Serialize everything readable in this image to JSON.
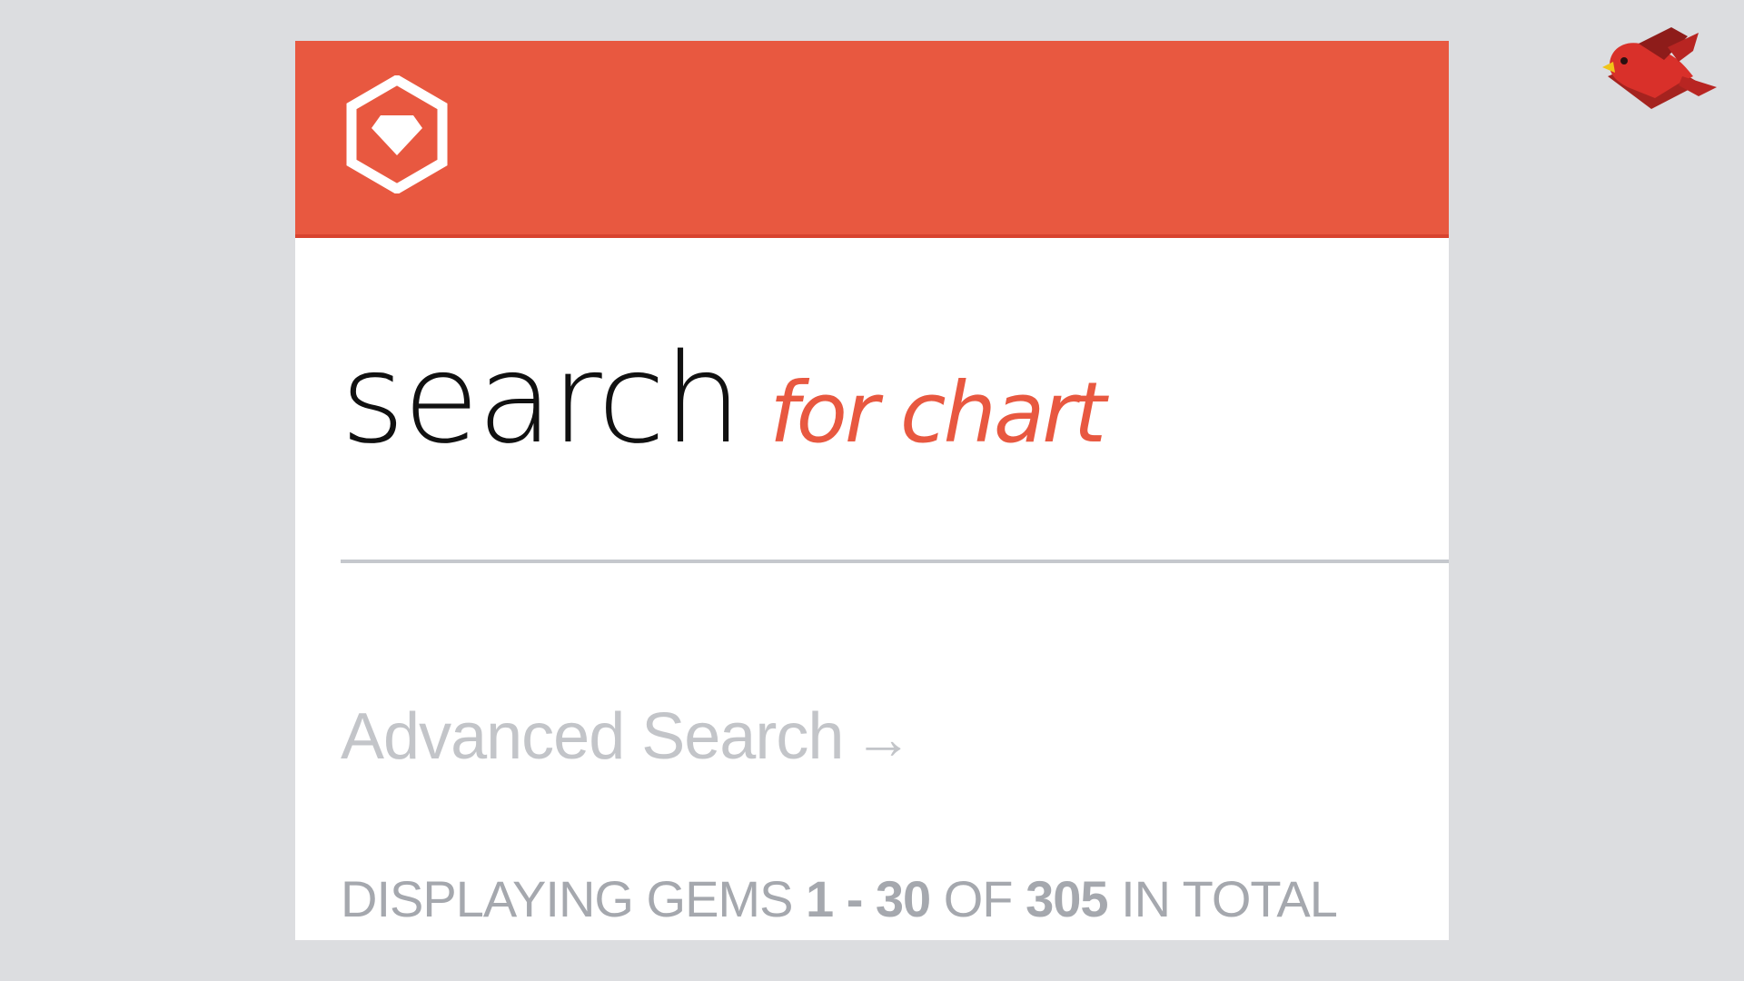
{
  "header": {
    "logo_icon": "rubygems-hexagon-gem-icon",
    "background_color": "#e85840"
  },
  "search": {
    "title": "search",
    "placeholder": "for chart",
    "accent_color": "#e85840"
  },
  "advanced_search": {
    "label": "Advanced Search",
    "arrow": "→"
  },
  "results_summary": {
    "prefix": "DISPLAYING GEMS",
    "range": "1 - 30",
    "of_label": "OF",
    "total": "305",
    "suffix": "IN TOTAL"
  },
  "mascot": {
    "icon": "red-bird-icon"
  }
}
